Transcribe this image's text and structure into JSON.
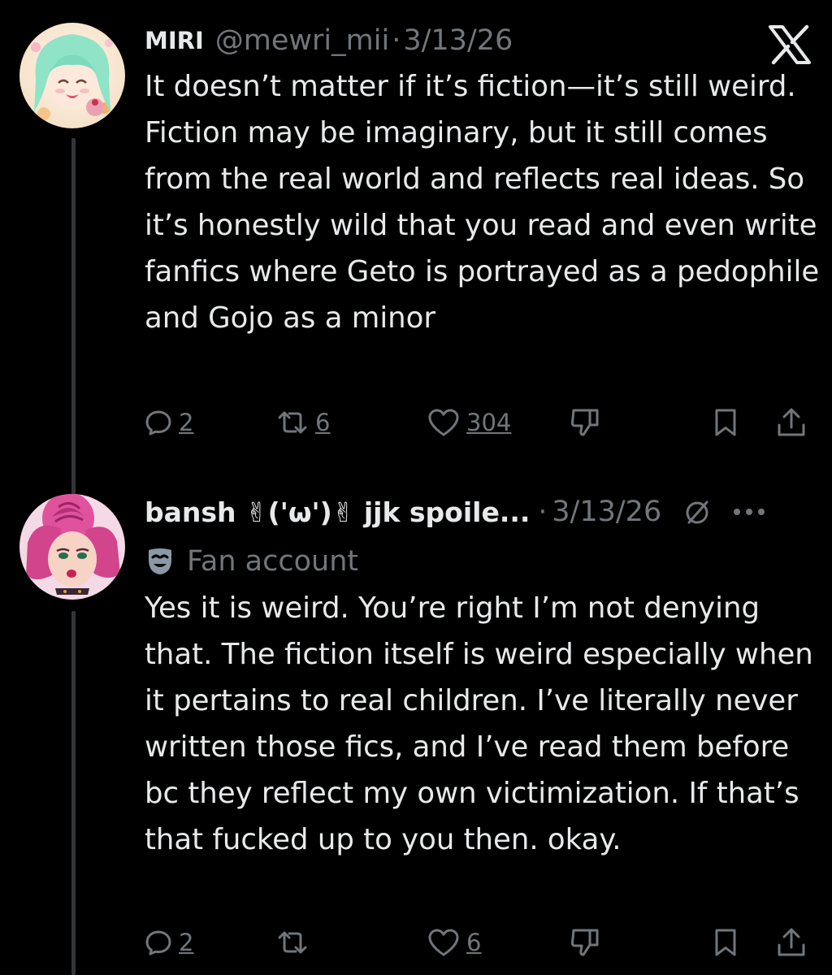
{
  "post1": {
    "name": "MIRI",
    "handle": "@mewri_mii",
    "separator": "·",
    "date": "3/13/26",
    "text": "It doesn’t matter if it’s fiction—it’s still weird. Fiction may be imaginary, but it still comes from the real world and reflects real ideas. So it’s honestly wild that you read and even write fanfics where Geto is portrayed as a pedophile and Gojo as a minor",
    "replies": "2",
    "reposts": "6",
    "likes": "304"
  },
  "post2": {
    "name": "bansh ✌︎('ω')✌︎ jjk spoile...",
    "separator": "·",
    "date": "3/13/26",
    "label": "Fan account",
    "text": "Yes it is weird. You’re right I’m not denying that. The fiction itself is weird especially when it pertains to real children. I’ve literally never written those fics, and I’ve read them before bc they reflect my own victimization. If that’s that fucked up to you then. okay.",
    "replies": "2",
    "likes": "6"
  },
  "colors": {
    "background": "#000000",
    "text": "#e7e9ea",
    "muted": "#71767b",
    "thread_line": "#333639"
  },
  "icons": {
    "platform": "x-logo-icon",
    "reply": "speech-bubble-icon",
    "repost": "repost-arrows-icon",
    "like": "heart-icon",
    "dislike": "thumbs-down-icon",
    "bookmark": "bookmark-icon",
    "share": "share-upload-icon",
    "more": "more-dots-icon",
    "grok": "slashed-circle-icon",
    "fan_account": "drama-mask-icon"
  }
}
